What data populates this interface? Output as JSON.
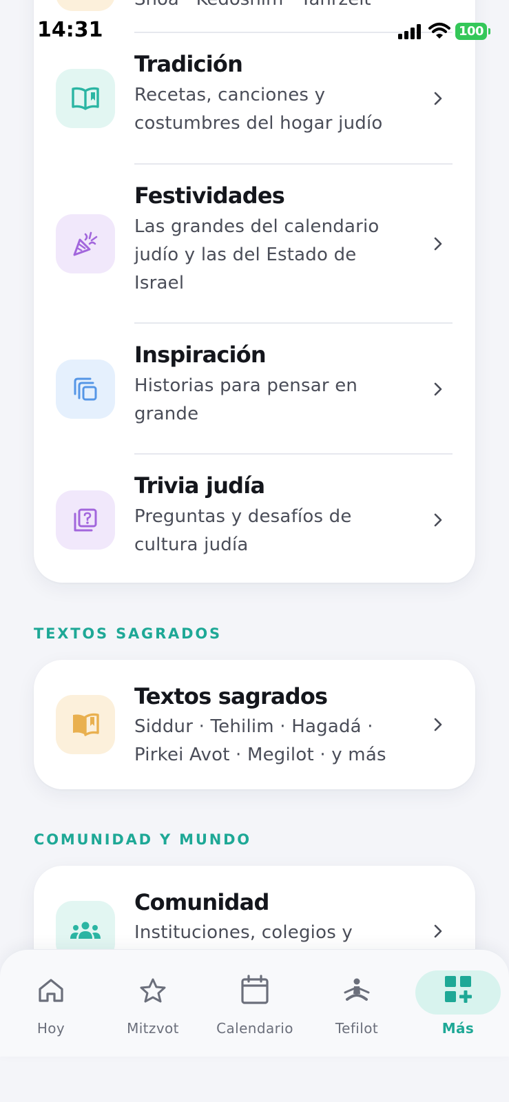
{
  "status_bar": {
    "time": "14:31",
    "battery": "100"
  },
  "top_card": {
    "partial_subtitle": "Shoá · Kedoshim · Yahrzeit",
    "items": [
      {
        "title": "Tradición",
        "subtitle": "Recetas, canciones y costumbres del hogar judío",
        "icon": "open-book-icon",
        "tile_color": "#e2f6f2",
        "icon_color": "#2bb5a3"
      },
      {
        "title": "Festividades",
        "subtitle": "Las grandes del calendario judío y las del Estado de Israel",
        "icon": "party-popper-icon",
        "tile_color": "#f1e8fb",
        "icon_color": "#a266dc"
      },
      {
        "title": "Inspiración",
        "subtitle": "Historias para pensar en grande",
        "icon": "copy-icon",
        "tile_color": "#e5f0fd",
        "icon_color": "#5596e6"
      },
      {
        "title": "Trivia judía",
        "subtitle": "Preguntas y desafíos de cultura judía",
        "icon": "quiz-icon",
        "tile_color": "#f1e8fb",
        "icon_color": "#a266dc"
      }
    ]
  },
  "sections": {
    "textos_label": "TEXTOS SAGRADOS",
    "textos_item": {
      "title": "Textos sagrados",
      "subtitle": "Siddur · Tehilim · Hagadá · Pirkei Avot · Megilot · y más",
      "icon": "book-icon",
      "tile_color": "#fcf0db",
      "icon_color": "#e9b04f"
    },
    "comunidad_label": "COMUNIDAD Y MUNDO",
    "comunidad_item": {
      "title": "Comunidad",
      "subtitle": "Instituciones, colegios y",
      "icon": "group-icon",
      "tile_color": "#e2f6f2",
      "icon_color": "#2bb5a3"
    }
  },
  "tab_bar": {
    "tabs": [
      {
        "label": "Hoy",
        "icon": "home-icon"
      },
      {
        "label": "Mitzvot",
        "icon": "star-icon"
      },
      {
        "label": "Calendario",
        "icon": "calendar-icon"
      },
      {
        "label": "Tefilot",
        "icon": "prayer-icon"
      },
      {
        "label": "Más",
        "icon": "grid-plus-icon",
        "active": true
      }
    ],
    "accent": "#1ea896"
  }
}
